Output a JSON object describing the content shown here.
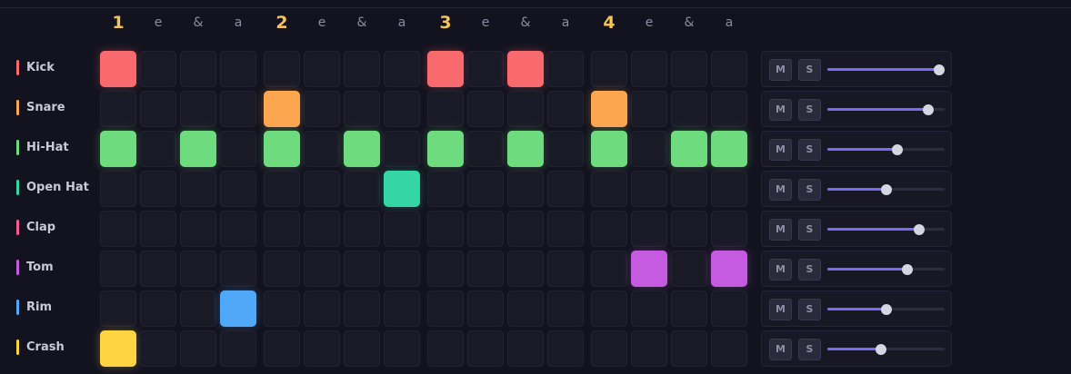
{
  "beats": [
    "1",
    "e",
    "&",
    "a",
    "2",
    "e",
    "&",
    "a",
    "3",
    "e",
    "&",
    "a",
    "4",
    "e",
    "&",
    "a"
  ],
  "controls": {
    "mute_label": "M",
    "solo_label": "S"
  },
  "tracks": [
    {
      "name": "Kick",
      "color": "#f96a6e",
      "volume": 0.95,
      "steps": [
        1,
        0,
        0,
        0,
        0,
        0,
        0,
        0,
        1,
        0,
        1,
        0,
        0,
        0,
        0,
        0
      ]
    },
    {
      "name": "Snare",
      "color": "#fca74f",
      "volume": 0.86,
      "steps": [
        0,
        0,
        0,
        0,
        1,
        0,
        0,
        0,
        0,
        0,
        0,
        0,
        1,
        0,
        0,
        0
      ]
    },
    {
      "name": "Hi-Hat",
      "color": "#6ddb7e",
      "volume": 0.6,
      "steps": [
        1,
        0,
        1,
        0,
        1,
        0,
        1,
        0,
        1,
        0,
        1,
        0,
        1,
        0,
        1,
        1
      ]
    },
    {
      "name": "Open Hat",
      "color": "#35d6a6",
      "volume": 0.5,
      "steps": [
        0,
        0,
        0,
        0,
        0,
        0,
        0,
        1,
        0,
        0,
        0,
        0,
        0,
        0,
        0,
        0
      ]
    },
    {
      "name": "Clap",
      "color": "#f25c8e",
      "volume": 0.78,
      "steps": [
        0,
        0,
        0,
        0,
        0,
        0,
        0,
        0,
        0,
        0,
        0,
        0,
        0,
        0,
        0,
        0
      ]
    },
    {
      "name": "Tom",
      "color": "#c45be0",
      "volume": 0.68,
      "steps": [
        0,
        0,
        0,
        0,
        0,
        0,
        0,
        0,
        0,
        0,
        0,
        0,
        0,
        1,
        0,
        1
      ]
    },
    {
      "name": "Rim",
      "color": "#4fa9f8",
      "volume": 0.5,
      "steps": [
        0,
        0,
        0,
        1,
        0,
        0,
        0,
        0,
        0,
        0,
        0,
        0,
        0,
        0,
        0,
        0
      ]
    },
    {
      "name": "Crash",
      "color": "#fdd441",
      "volume": 0.46,
      "steps": [
        1,
        0,
        0,
        0,
        0,
        0,
        0,
        0,
        0,
        0,
        0,
        0,
        0,
        0,
        0,
        0
      ]
    }
  ]
}
